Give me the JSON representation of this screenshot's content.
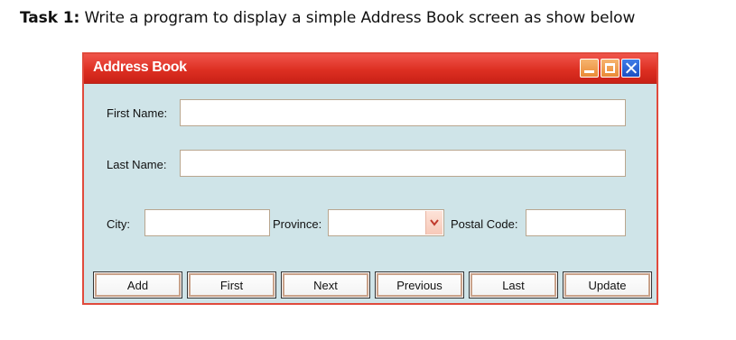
{
  "task": {
    "prefix": "Task 1:",
    "text": " Write a program to display a simple Address Book screen as show below"
  },
  "window": {
    "title": "Address Book",
    "controls": {
      "minimize": "minimize-icon",
      "maximize": "maximize-icon",
      "close": "close-icon"
    },
    "colors": {
      "frame": "#e04a3c",
      "background": "#cfe4e8",
      "close": "#1c4fc2",
      "minmax": "#ea8a35"
    }
  },
  "form": {
    "first_name_label": "First Name:",
    "first_name_value": "",
    "last_name_label": "Last Name:",
    "last_name_value": "",
    "city_label": "City:",
    "city_value": "",
    "province_label": "Province:",
    "province_value": "",
    "postal_code_label": "Postal Code:",
    "postal_code_value": ""
  },
  "buttons": {
    "add": "Add",
    "first": "First",
    "next": "Next",
    "previous": "Previous",
    "last": "Last",
    "update": "Update"
  }
}
